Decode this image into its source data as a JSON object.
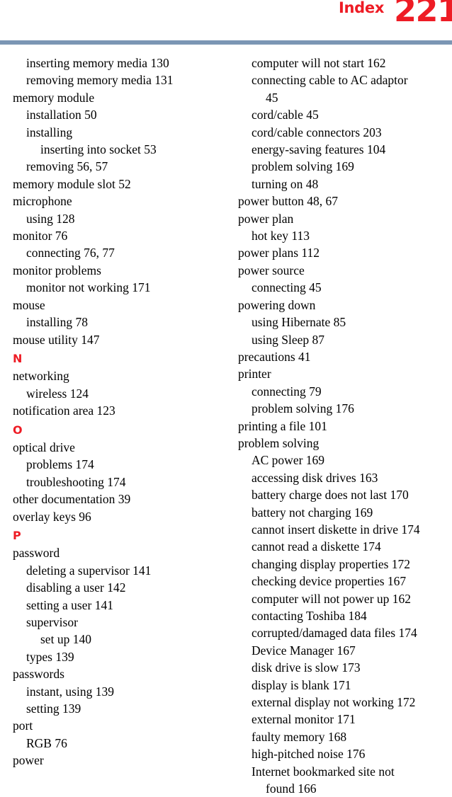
{
  "header": {
    "title": "Index",
    "page_number": "221",
    "accent_color": "#ee1c25",
    "rule_color": "#7b96b4"
  },
  "columns": {
    "left": [
      {
        "kind": "entry",
        "level": 1,
        "text": "inserting memory media 130"
      },
      {
        "kind": "entry",
        "level": 1,
        "text": "removing memory media 131"
      },
      {
        "kind": "entry",
        "level": 0,
        "text": "memory module"
      },
      {
        "kind": "entry",
        "level": 1,
        "text": "installation 50"
      },
      {
        "kind": "entry",
        "level": 1,
        "text": "installing"
      },
      {
        "kind": "entry",
        "level": 2,
        "text": "inserting into socket 53"
      },
      {
        "kind": "entry",
        "level": 1,
        "text": "removing 56, 57"
      },
      {
        "kind": "entry",
        "level": 0,
        "text": "memory module slot 52"
      },
      {
        "kind": "entry",
        "level": 0,
        "text": "microphone"
      },
      {
        "kind": "entry",
        "level": 1,
        "text": "using 128"
      },
      {
        "kind": "entry",
        "level": 0,
        "text": "monitor 76"
      },
      {
        "kind": "entry",
        "level": 1,
        "text": "connecting 76, 77"
      },
      {
        "kind": "entry",
        "level": 0,
        "text": "monitor problems"
      },
      {
        "kind": "entry",
        "level": 1,
        "text": "monitor not working 171"
      },
      {
        "kind": "entry",
        "level": 0,
        "text": "mouse"
      },
      {
        "kind": "entry",
        "level": 1,
        "text": "installing 78"
      },
      {
        "kind": "entry",
        "level": 0,
        "text": "mouse utility 147"
      },
      {
        "kind": "letter",
        "level": 0,
        "text": "N"
      },
      {
        "kind": "entry",
        "level": 0,
        "text": "networking"
      },
      {
        "kind": "entry",
        "level": 1,
        "text": "wireless 124"
      },
      {
        "kind": "entry",
        "level": 0,
        "text": "notification area 123"
      },
      {
        "kind": "letter",
        "level": 0,
        "text": "O"
      },
      {
        "kind": "entry",
        "level": 0,
        "text": "optical drive"
      },
      {
        "kind": "entry",
        "level": 1,
        "text": "problems 174"
      },
      {
        "kind": "entry",
        "level": 1,
        "text": "troubleshooting 174"
      },
      {
        "kind": "entry",
        "level": 0,
        "text": "other documentation 39"
      },
      {
        "kind": "entry",
        "level": 0,
        "text": "overlay keys 96"
      },
      {
        "kind": "letter",
        "level": 0,
        "text": "P"
      },
      {
        "kind": "entry",
        "level": 0,
        "text": "password"
      },
      {
        "kind": "entry",
        "level": 1,
        "text": "deleting a supervisor 141"
      },
      {
        "kind": "entry",
        "level": 1,
        "text": "disabling a user 142"
      },
      {
        "kind": "entry",
        "level": 1,
        "text": "setting a user 141"
      },
      {
        "kind": "entry",
        "level": 1,
        "text": "supervisor"
      },
      {
        "kind": "entry",
        "level": 2,
        "text": "set up 140"
      },
      {
        "kind": "entry",
        "level": 1,
        "text": "types 139"
      },
      {
        "kind": "entry",
        "level": 0,
        "text": "passwords"
      },
      {
        "kind": "entry",
        "level": 1,
        "text": "instant, using 139"
      },
      {
        "kind": "entry",
        "level": 1,
        "text": "setting 139"
      },
      {
        "kind": "entry",
        "level": 0,
        "text": "port"
      },
      {
        "kind": "entry",
        "level": 1,
        "text": "RGB 76"
      },
      {
        "kind": "entry",
        "level": 0,
        "text": "power"
      }
    ],
    "right": [
      {
        "kind": "entry",
        "level": 1,
        "text": "computer will not start 162"
      },
      {
        "kind": "entry",
        "level": 1,
        "text": "connecting cable to AC adaptor"
      },
      {
        "kind": "entry",
        "level": 2,
        "text": "45"
      },
      {
        "kind": "entry",
        "level": 1,
        "text": "cord/cable 45"
      },
      {
        "kind": "entry",
        "level": 1,
        "text": "cord/cable connectors 203"
      },
      {
        "kind": "entry",
        "level": 1,
        "text": "energy-saving features 104"
      },
      {
        "kind": "entry",
        "level": 1,
        "text": "problem solving 169"
      },
      {
        "kind": "entry",
        "level": 1,
        "text": "turning on 48"
      },
      {
        "kind": "entry",
        "level": 0,
        "text": "power button 48, 67"
      },
      {
        "kind": "entry",
        "level": 0,
        "text": "power plan"
      },
      {
        "kind": "entry",
        "level": 1,
        "text": "hot key 113"
      },
      {
        "kind": "entry",
        "level": 0,
        "text": "power plans 112"
      },
      {
        "kind": "entry",
        "level": 0,
        "text": "power source"
      },
      {
        "kind": "entry",
        "level": 1,
        "text": "connecting 45"
      },
      {
        "kind": "entry",
        "level": 0,
        "text": "powering down"
      },
      {
        "kind": "entry",
        "level": 1,
        "text": "using Hibernate 85"
      },
      {
        "kind": "entry",
        "level": 1,
        "text": "using Sleep 87"
      },
      {
        "kind": "entry",
        "level": 0,
        "text": "precautions 41"
      },
      {
        "kind": "entry",
        "level": 0,
        "text": "printer"
      },
      {
        "kind": "entry",
        "level": 1,
        "text": "connecting 79"
      },
      {
        "kind": "entry",
        "level": 1,
        "text": "problem solving 176"
      },
      {
        "kind": "entry",
        "level": 0,
        "text": "printing a file 101"
      },
      {
        "kind": "entry",
        "level": 0,
        "text": "problem solving"
      },
      {
        "kind": "entry",
        "level": 1,
        "text": "AC power 169"
      },
      {
        "kind": "entry",
        "level": 1,
        "text": "accessing disk drives 163"
      },
      {
        "kind": "entry",
        "level": 1,
        "text": "battery charge does not last 170"
      },
      {
        "kind": "entry",
        "level": 1,
        "text": "battery not charging 169"
      },
      {
        "kind": "entry",
        "level": 1,
        "text": "cannot insert diskette in drive 174"
      },
      {
        "kind": "entry",
        "level": 1,
        "text": "cannot read a diskette 174"
      },
      {
        "kind": "entry",
        "level": 1,
        "text": "changing display properties 172"
      },
      {
        "kind": "entry",
        "level": 1,
        "text": "checking device properties 167"
      },
      {
        "kind": "entry",
        "level": 1,
        "text": "computer will not power up 162"
      },
      {
        "kind": "entry",
        "level": 1,
        "text": "contacting Toshiba 184"
      },
      {
        "kind": "entry",
        "level": 1,
        "text": "corrupted/damaged data files 174"
      },
      {
        "kind": "entry",
        "level": 1,
        "text": "Device Manager 167"
      },
      {
        "kind": "entry",
        "level": 1,
        "text": "disk drive is slow 173"
      },
      {
        "kind": "entry",
        "level": 1,
        "text": "display is blank 171"
      },
      {
        "kind": "entry",
        "level": 1,
        "text": "external display not working 172"
      },
      {
        "kind": "entry",
        "level": 1,
        "text": "external monitor 171"
      },
      {
        "kind": "entry",
        "level": 1,
        "text": "faulty memory 168"
      },
      {
        "kind": "entry",
        "level": 1,
        "text": "high-pitched noise 176"
      },
      {
        "kind": "entry",
        "level": 1,
        "text": "Internet bookmarked site not"
      },
      {
        "kind": "entry",
        "level": 2,
        "text": "found 166"
      }
    ]
  }
}
